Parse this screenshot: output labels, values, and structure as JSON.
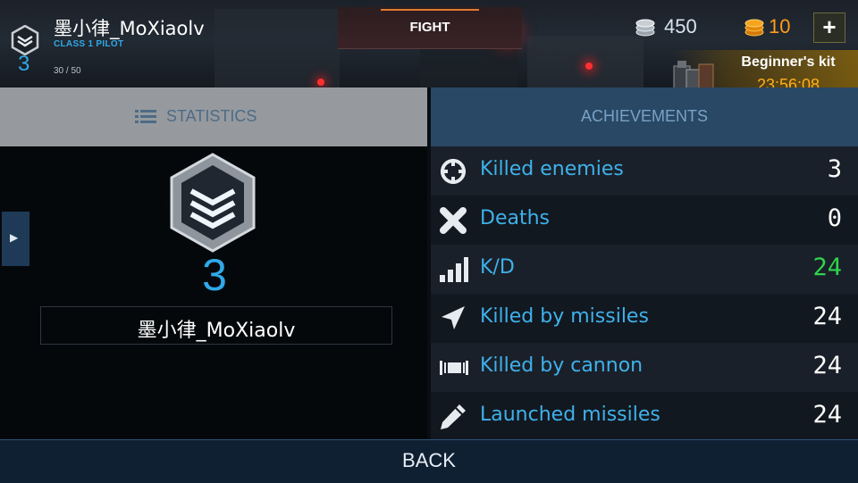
{
  "player": {
    "name": "墨小律_MoXiaolv",
    "class": "CLASS 1 PILOT",
    "rank": "3",
    "xp": "30 / 50"
  },
  "top_tab": {
    "label": "FIGHT"
  },
  "currency": {
    "silver": "450",
    "gold": "10",
    "add_label": "+"
  },
  "offer": {
    "title": "Beginner's kit",
    "timer": "23:56:08"
  },
  "tabs": {
    "statistics": "STATISTICS",
    "achievements": "ACHIEVEMENTS"
  },
  "profile": {
    "rank": "3",
    "name": "墨小律_MoXiaolv"
  },
  "stats": [
    {
      "label": "Killed enemies",
      "value": "3",
      "icon": "crosshair-icon"
    },
    {
      "label": "Deaths",
      "value": "0",
      "icon": "cross-icon"
    },
    {
      "label": "K/D",
      "value": "24",
      "icon": "bars-icon",
      "color": "#2ed44a"
    },
    {
      "label": "Killed by missiles",
      "value": "24",
      "icon": "missile-icon"
    },
    {
      "label": "Killed by cannon",
      "value": "24",
      "icon": "cannon-icon"
    },
    {
      "label": "Launched missiles",
      "value": "24",
      "icon": "pencil-icon"
    }
  ],
  "footer": {
    "back_label": "BACK"
  }
}
